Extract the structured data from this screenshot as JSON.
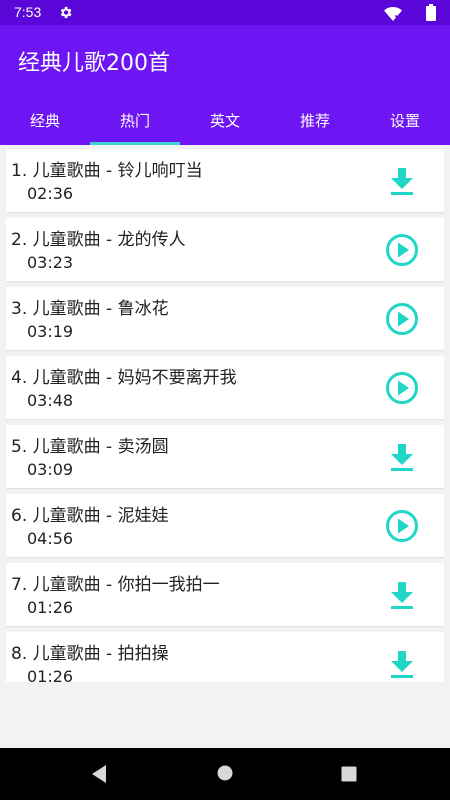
{
  "status": {
    "time": "7:53"
  },
  "app": {
    "title": "经典儿歌200首"
  },
  "tabs": [
    {
      "label": "经典",
      "active": false
    },
    {
      "label": "热门",
      "active": true
    },
    {
      "label": "英文",
      "active": false
    },
    {
      "label": "推荐",
      "active": false
    },
    {
      "label": "设置",
      "active": false
    }
  ],
  "songs": [
    {
      "title": "1. 儿童歌曲 - 铃儿响叮当",
      "duration": "02:36",
      "icon": "download-icon"
    },
    {
      "title": "2. 儿童歌曲 - 龙的传人",
      "duration": "03:23",
      "icon": "play-circle-icon"
    },
    {
      "title": "3. 儿童歌曲 - 鲁冰花",
      "duration": "03:19",
      "icon": "play-circle-icon"
    },
    {
      "title": "4. 儿童歌曲 - 妈妈不要离开我",
      "duration": "03:48",
      "icon": "play-circle-icon"
    },
    {
      "title": "5. 儿童歌曲 - 卖汤圆",
      "duration": "03:09",
      "icon": "download-icon"
    },
    {
      "title": "6. 儿童歌曲 - 泥娃娃",
      "duration": "04:56",
      "icon": "play-circle-icon"
    },
    {
      "title": "7. 儿童歌曲 - 你拍一我拍一",
      "duration": "01:26",
      "icon": "download-icon"
    },
    {
      "title": "8. 儿童歌曲 - 拍拍操",
      "duration": "01:26",
      "icon": "download-icon"
    }
  ],
  "colors": {
    "status_bar": "#5a06d8",
    "app_bar": "#6d15f2",
    "accent": "#1fd6c7",
    "tab_indicator": "#3ed3d0"
  }
}
